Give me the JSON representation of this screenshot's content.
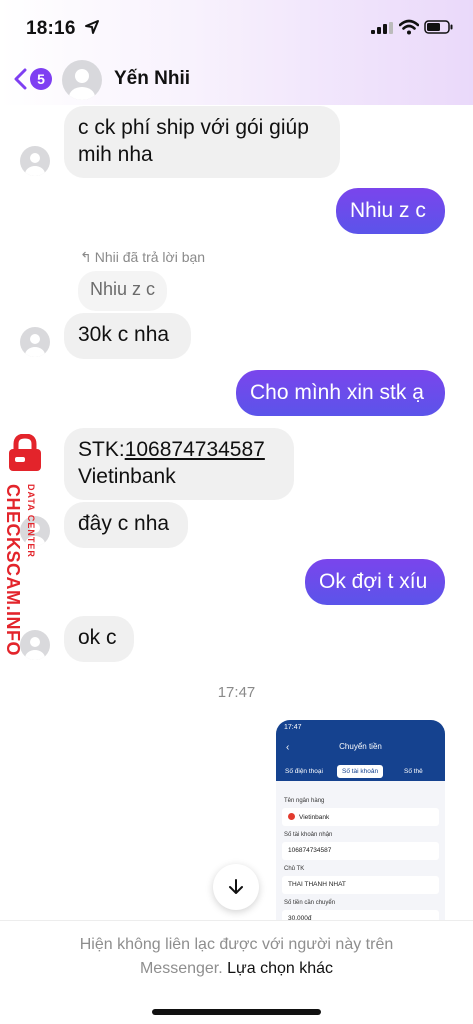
{
  "status_bar": {
    "time": "18:16"
  },
  "header": {
    "back_count": "5",
    "contact_name": "Yến Nhii"
  },
  "messages": {
    "m1": "c ck phí ship với gói giúp",
    "m1b": "mih nha",
    "m2": "Nhiu z c",
    "reply_note": "Nhii đã trả lời bạn",
    "replied_quote": "Nhiu z c",
    "m3": "30k c nha",
    "m4": "Cho mình xin stk ạ",
    "m5_prefix": "STK:",
    "m5_account": "106874734587",
    "m5b": "Vietinbank",
    "m6": "đây c nha",
    "m7": "Ok đợi t xíu",
    "m8": "ok c",
    "timestamp": "17:47"
  },
  "shared_image": {
    "time": "17:47",
    "title": "Chuyển tiền",
    "tabs": [
      "Số điện thoại",
      "Số tài khoản",
      "Số thẻ"
    ],
    "bank_label": "Tên ngân hàng",
    "bank_value": "Vietinbank",
    "account_label": "Số tài khoản nhận",
    "account_value": "106874734587",
    "holder_label": "Chủ TK",
    "holder_value": "THAI THANH NHAT",
    "amount_label": "Số tiền cần chuyển",
    "amount_value": "30,000đ"
  },
  "footer": {
    "notice": "Hiện không liên lạc được với người này trên",
    "notice_2": "Messenger.",
    "link": "Lựa chọn khác"
  },
  "watermark": {
    "line1": "CHECKSCAM.INFO",
    "line2": "DATA CENTER"
  },
  "colors": {
    "outgoing_bubble": "#6a4de9",
    "incoming_bubble": "#f0f0f0",
    "badge": "#7e3ff2",
    "watermark": "#e3242b"
  }
}
